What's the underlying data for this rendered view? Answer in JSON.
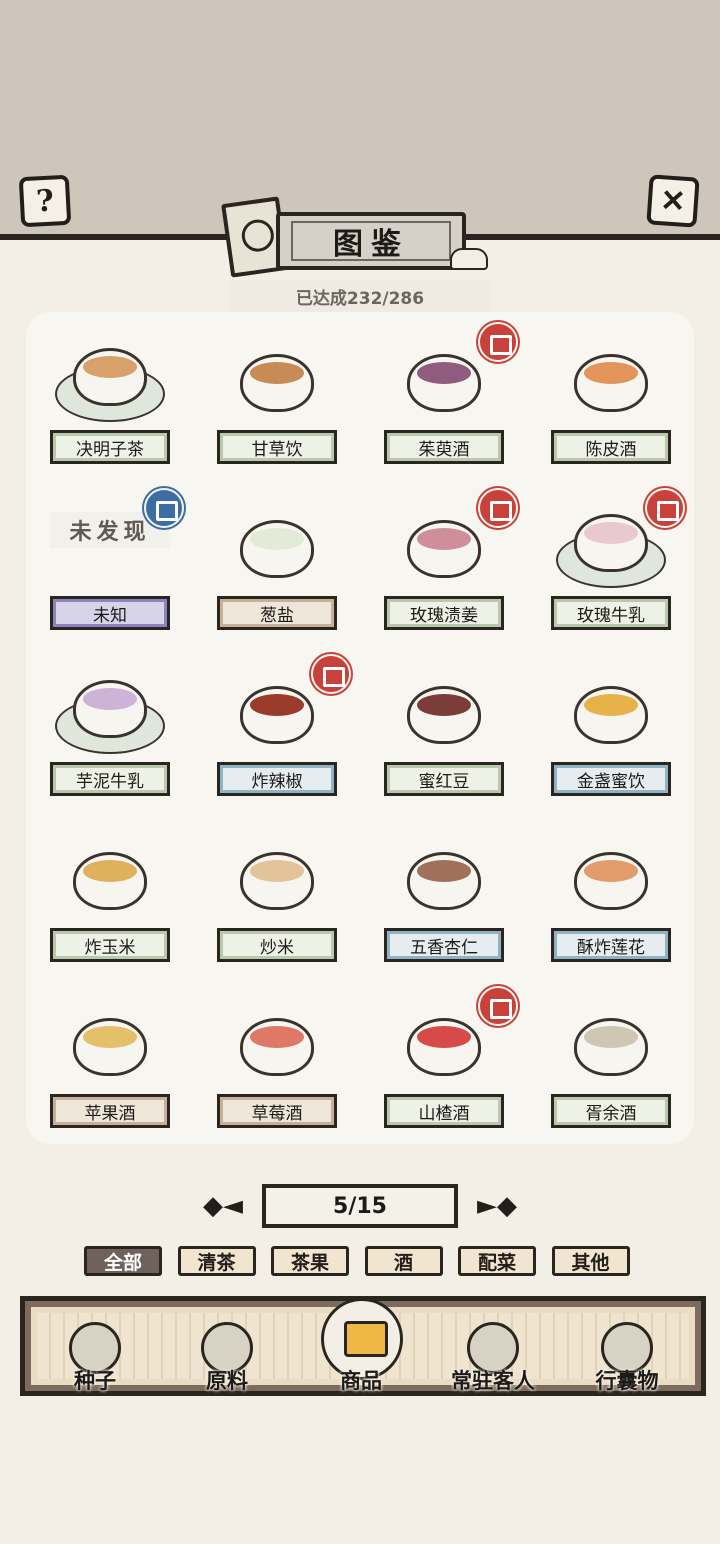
{
  "header": {
    "help_icon": "question-mark-icon",
    "close_icon": "close-x-icon",
    "title": "图鉴",
    "progress": "已达成232/286"
  },
  "items": [
    {
      "name": "决明子茶",
      "status": "unlocked",
      "new_badge": false,
      "style": "green",
      "liquid": "#d8a06a",
      "plate": true
    },
    {
      "name": "甘草饮",
      "status": "unlocked",
      "new_badge": false,
      "style": "green",
      "liquid": "#c98b56",
      "plate": false
    },
    {
      "name": "茱萸酒",
      "status": "unlocked",
      "new_badge": true,
      "style": "green",
      "liquid": "#8f5b7e",
      "plate": false
    },
    {
      "name": "陈皮酒",
      "status": "unlocked",
      "new_badge": false,
      "style": "green",
      "liquid": "#e3945a",
      "plate": false
    },
    {
      "name": "未知",
      "status": "undiscovered",
      "placeholder": "未发现",
      "new_badge": true,
      "style": "purple"
    },
    {
      "name": "葱盐",
      "status": "unlocked",
      "new_badge": false,
      "style": "tan",
      "liquid": "#e4ead8",
      "plate": false
    },
    {
      "name": "玫瑰渍姜",
      "status": "unlocked",
      "new_badge": true,
      "style": "green",
      "liquid": "#cf8e9a",
      "plate": false
    },
    {
      "name": "玫瑰牛乳",
      "status": "unlocked",
      "new_badge": true,
      "style": "green",
      "liquid": "#e8c9cf",
      "plate": true
    },
    {
      "name": "芋泥牛乳",
      "status": "unlocked",
      "new_badge": false,
      "style": "green",
      "liquid": "#cdb3d8",
      "plate": true
    },
    {
      "name": "炸辣椒",
      "status": "unlocked",
      "new_badge": true,
      "style": "blue",
      "liquid": "#9b3b2c",
      "plate": false
    },
    {
      "name": "蜜红豆",
      "status": "unlocked",
      "new_badge": false,
      "style": "green",
      "liquid": "#7a3d3a",
      "plate": false
    },
    {
      "name": "金盏蜜饮",
      "status": "unlocked",
      "new_badge": false,
      "style": "blue",
      "liquid": "#e8b24a",
      "plate": false
    },
    {
      "name": "炸玉米",
      "status": "unlocked",
      "new_badge": false,
      "style": "green",
      "liquid": "#e0b15c",
      "plate": false
    },
    {
      "name": "炒米",
      "status": "unlocked",
      "new_badge": false,
      "style": "green",
      "liquid": "#e2c39a",
      "plate": false
    },
    {
      "name": "五香杏仁",
      "status": "unlocked",
      "new_badge": false,
      "style": "blue",
      "liquid": "#a0705a",
      "plate": false
    },
    {
      "name": "酥炸莲花",
      "status": "unlocked",
      "new_badge": false,
      "style": "blue",
      "liquid": "#e29b6a",
      "plate": false
    },
    {
      "name": "苹果酒",
      "status": "unlocked",
      "new_badge": false,
      "style": "tan",
      "liquid": "#e4c06a",
      "plate": false
    },
    {
      "name": "草莓酒",
      "status": "unlocked",
      "new_badge": false,
      "style": "tan",
      "liquid": "#e07868",
      "plate": false
    },
    {
      "name": "山楂酒",
      "status": "unlocked",
      "new_badge": true,
      "style": "green",
      "liquid": "#d84a4a",
      "plate": false
    },
    {
      "name": "胥余酒",
      "status": "unlocked",
      "new_badge": false,
      "style": "green",
      "liquid": "#cfc7b4",
      "plate": false
    }
  ],
  "pagination": {
    "label": "5/15",
    "prev_icon": "ornate-arrow-left-icon",
    "next_icon": "ornate-arrow-right-icon"
  },
  "categories": [
    {
      "label": "全部",
      "active": true
    },
    {
      "label": "清茶",
      "active": false
    },
    {
      "label": "茶果",
      "active": false
    },
    {
      "label": "酒",
      "active": false
    },
    {
      "label": "配菜",
      "active": false
    },
    {
      "label": "其他",
      "active": false
    }
  ],
  "bottom_nav": [
    {
      "label": "种子",
      "icon": "seed-jar-icon",
      "active": false
    },
    {
      "label": "原料",
      "icon": "leaf-icon",
      "active": false
    },
    {
      "label": "商品",
      "icon": "pastry-plate-icon",
      "active": true
    },
    {
      "label": "常驻客人",
      "icon": "girl-guest-icon",
      "active": false
    },
    {
      "label": "行囊物",
      "icon": "robe-icon",
      "active": false
    }
  ]
}
